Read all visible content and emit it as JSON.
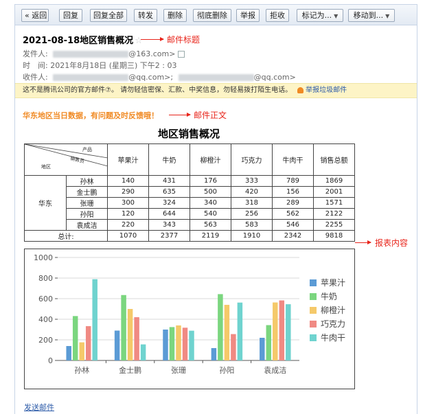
{
  "toolbar": {
    "back": "« 返回",
    "reply": "回复",
    "reply_all": "回复全部",
    "forward": "转发",
    "delete": "删除",
    "delete_permanently": "彻底删除",
    "report": "举报",
    "reject": "拒收",
    "mark_as": "标记为...",
    "move_to": "移动到..."
  },
  "email": {
    "subject": "2021-08-18地区销售概况",
    "star": "☆",
    "from_label": "发件人:",
    "from_domain": "@163.com>",
    "time_label": "时　间:",
    "time_value": "2021年8月18日 (星期三) 下午2 : 03",
    "to_label": "收件人:",
    "to_domain_1": "@qq.com>;",
    "to_domain_2": "@qq.com>"
  },
  "notice": {
    "text": "这不是腾讯公司的官方邮件⑦。 请勿轻信密保、汇款、中奖信息，勿轻易拨打陌生电话。",
    "report_link": "举报垃圾邮件"
  },
  "annotations": {
    "subject_note": "邮件标题",
    "body_note": "邮件正文",
    "report_note": "报表内容"
  },
  "body": {
    "intro": "华东地区当日数据，有问题及时反馈哦！",
    "report_title": "地区销售概况",
    "send_link": "发送邮件"
  },
  "table": {
    "header_product": "产品",
    "header_salesperson": "销售员",
    "header_region": "地区",
    "columns": [
      "苹果汁",
      "牛奶",
      "柳橙汁",
      "巧克力",
      "牛肉干",
      "销售总额"
    ],
    "region": "华东",
    "rows": [
      {
        "name": "孙林",
        "values": [
          "140",
          "431",
          "176",
          "333",
          "789",
          "1869"
        ]
      },
      {
        "name": "金士鹏",
        "values": [
          "290",
          "635",
          "500",
          "420",
          "156",
          "2001"
        ]
      },
      {
        "name": "张珊",
        "values": [
          "300",
          "324",
          "340",
          "318",
          "289",
          "1571"
        ]
      },
      {
        "name": "孙阳",
        "values": [
          "120",
          "644",
          "540",
          "256",
          "562",
          "2122"
        ]
      },
      {
        "name": "袁成洁",
        "values": [
          "220",
          "343",
          "563",
          "583",
          "546",
          "2255"
        ]
      }
    ],
    "total_label": "总计:",
    "totals": [
      "1070",
      "2377",
      "2119",
      "1910",
      "2342",
      "9818"
    ]
  },
  "chart_data": {
    "type": "bar",
    "categories": [
      "孙林",
      "金士鹏",
      "张珊",
      "孙阳",
      "袁成洁"
    ],
    "series": [
      {
        "name": "苹果汁",
        "color": "#5b9bd5",
        "values": [
          140,
          290,
          300,
          120,
          220
        ]
      },
      {
        "name": "牛奶",
        "color": "#7bd67f",
        "values": [
          431,
          635,
          324,
          644,
          343
        ]
      },
      {
        "name": "柳橙汁",
        "color": "#f5c96a",
        "values": [
          176,
          500,
          340,
          540,
          563
        ]
      },
      {
        "name": "巧克力",
        "color": "#f08a83",
        "values": [
          333,
          420,
          318,
          256,
          583
        ]
      },
      {
        "name": "牛肉干",
        "color": "#6fd3cf",
        "values": [
          789,
          156,
          289,
          562,
          546
        ]
      }
    ],
    "ylim": [
      0,
      1000
    ],
    "yticks": [
      "0",
      "200",
      "400",
      "600",
      "800",
      "1000"
    ],
    "legend": "right",
    "grid": true,
    "title": "",
    "xlabel": "",
    "ylabel": ""
  }
}
